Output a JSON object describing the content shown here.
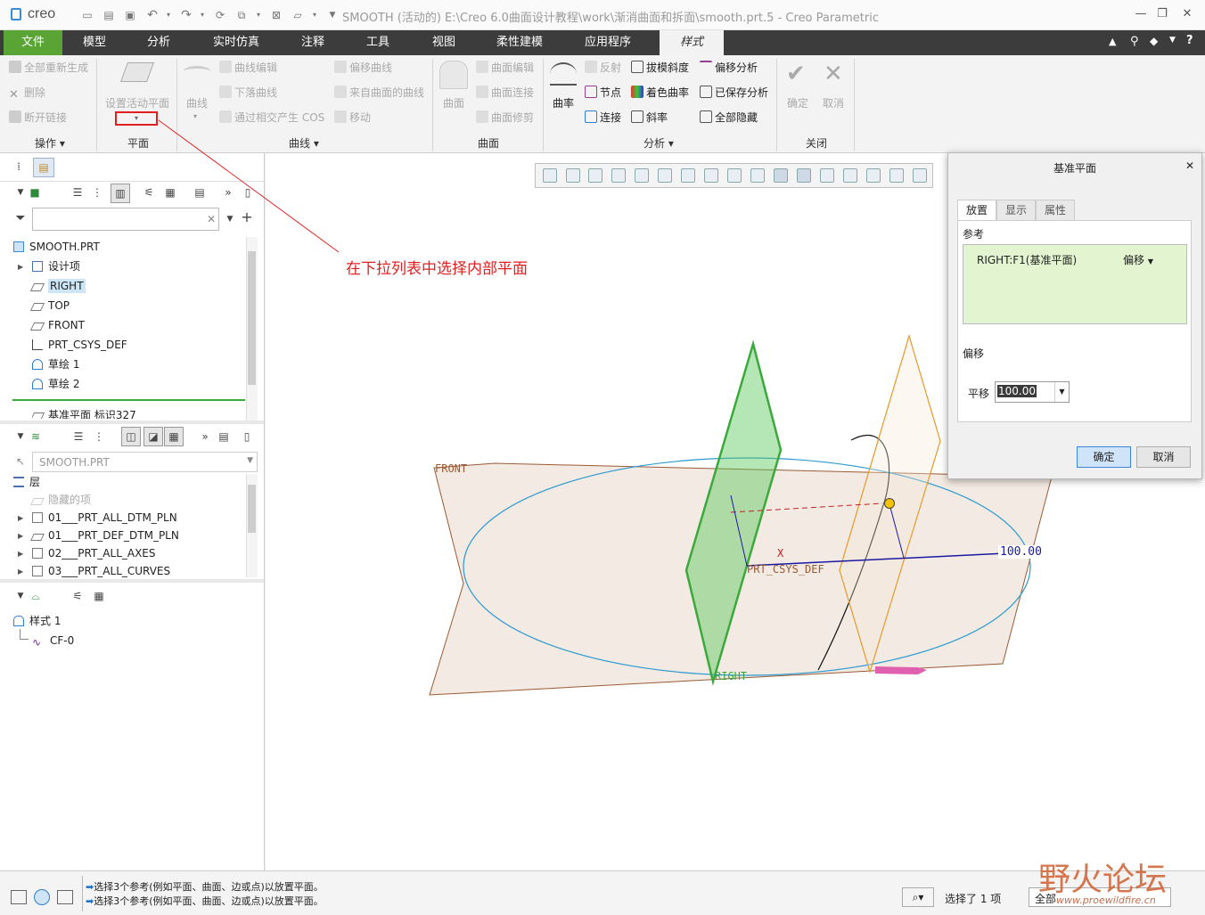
{
  "app": {
    "logo": "creo",
    "title": "SMOOTH (活动的) E:\\Creo 6.0曲面设计教程\\work\\渐消曲面和拆面\\smooth.prt.5 - Creo Parametric"
  },
  "menu": {
    "tabs": [
      "文件",
      "模型",
      "分析",
      "实时仿真",
      "注释",
      "工具",
      "视图",
      "柔性建模",
      "应用程序",
      "样式"
    ]
  },
  "ribbon": {
    "ops": {
      "regen_all": "全部重新生成",
      "delete": "删除",
      "break_link": "断开链接",
      "group_label": "操作"
    },
    "plane": {
      "set_active": "设置活动平面",
      "group_label": "平面"
    },
    "curves": {
      "curve": "曲线",
      "curve_edit": "曲线编辑",
      "drop_curve": "下落曲线",
      "cos": "通过相交产生 COS",
      "offset_curve": "偏移曲线",
      "from_surface": "来自曲面的曲线",
      "move": "移动",
      "group_label": "曲线"
    },
    "surfaces": {
      "surface": "曲面",
      "surface_edit": "曲面编辑",
      "surface_connect": "曲面连接",
      "surface_trim": "曲面修剪",
      "group_label": "曲面"
    },
    "analysis": {
      "curvature": "曲率",
      "reflect": "反射",
      "draft": "拔模斜度",
      "offset_analysis": "偏移分析",
      "node": "节点",
      "shaded_curvature": "着色曲率",
      "saved_analysis": "已保存分析",
      "connect": "连接",
      "slope": "斜率",
      "hide_all": "全部隐藏",
      "group_label": "分析"
    },
    "close": {
      "ok": "确定",
      "cancel": "取消",
      "group_label": "关闭"
    }
  },
  "annotation": "在下拉列表中选择内部平面",
  "model_tree": {
    "root": "SMOOTH.PRT",
    "items": [
      "设计项",
      "RIGHT",
      "TOP",
      "FRONT",
      "PRT_CSYS_DEF",
      "草绘 1",
      "草绘 2",
      "基准平面 标识327"
    ],
    "selected": "RIGHT"
  },
  "layer_tree": {
    "model_select": "SMOOTH.PRT",
    "root": "层",
    "hidden_items": "隐藏的项",
    "items": [
      "01___PRT_ALL_DTM_PLN",
      "01___PRT_DEF_DTM_PLN",
      "02___PRT_ALL_AXES",
      "03___PRT_ALL_CURVES"
    ]
  },
  "style_tree": {
    "root": "样式 1",
    "items": [
      "CF-0"
    ]
  },
  "viewport_labels": {
    "front": "FRONT",
    "right": "RIGHT",
    "csys": "PRT_CSYS_DEF",
    "x_axis": "X",
    "dimension": "100.00"
  },
  "dialog": {
    "title": "基准平面",
    "tabs": [
      "放置",
      "显示",
      "属性"
    ],
    "reference_label": "参考",
    "reference_item": "RIGHT:F1(基准平面)",
    "reference_type": "偏移",
    "offset_label": "偏移",
    "translate_label": "平移",
    "translate_value": "100.00",
    "ok": "确定",
    "cancel": "取消"
  },
  "status": {
    "messages": [
      "选择3个参考(例如平面、曲面、边或点)以放置平面。",
      "选择3个参考(例如平面、曲面、边或点)以放置平面。"
    ],
    "selected_count": "选择了 1 项",
    "filter": "全部"
  },
  "watermark": {
    "text": "野火论坛",
    "url": "www.proewildfire.cn"
  },
  "colors": {
    "menu_bg": "#3c3c3c",
    "file_tab": "#5aa335",
    "annotation": "#e02020",
    "selection": "#3ba93b",
    "highlight": "#cde6f7"
  }
}
